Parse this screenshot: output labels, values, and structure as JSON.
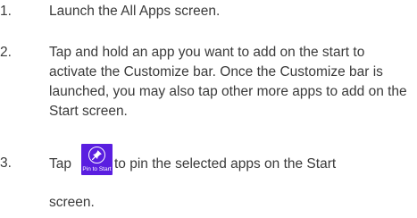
{
  "steps": [
    {
      "number": "1.",
      "text": "Launch the All Apps screen."
    },
    {
      "number": "2.",
      "text": "Tap and hold an app you want to add on the start to activate the Customize bar. Once the Customize bar is launched, you may also tap other more apps to add on the Start screen."
    },
    {
      "number": "3.",
      "text_before": "Tap",
      "text_after": "to pin the selected apps on the Start",
      "text_continued": "screen.",
      "icon": {
        "name": "pin-icon",
        "caption": "Pin to Start",
        "color": "#5a1ee0"
      }
    }
  ]
}
